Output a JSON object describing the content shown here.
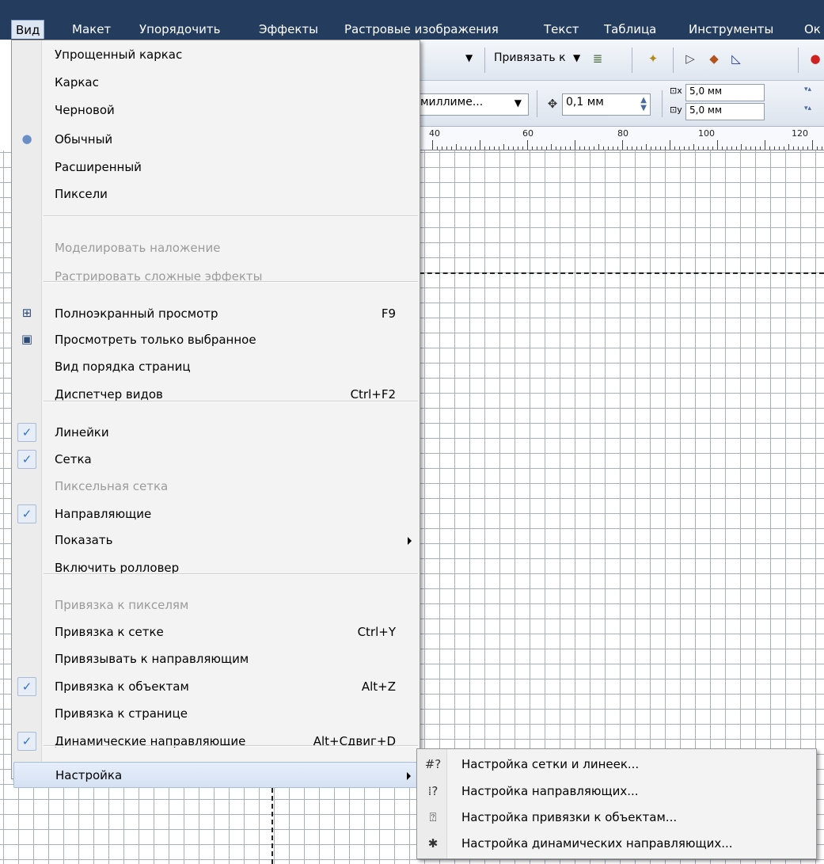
{
  "menubar": {
    "items": [
      "Вид",
      "Макет",
      "Упорядочить",
      "Эффекты",
      "Растровые изображения",
      "Текст",
      "Таблица",
      "Инструменты",
      "Ок"
    ]
  },
  "toolbar": {
    "snap_label": "Привязать к",
    "units": "миллиме...",
    "nudge": "0,1 мм",
    "dup_x": "5,0 мм",
    "dup_y": "5,0 мм"
  },
  "ruler": {
    "labels": [
      "40",
      "60",
      "80",
      "100",
      "120"
    ]
  },
  "view_menu": {
    "items": [
      {
        "label": "Упрощенный каркас",
        "shortcut": "",
        "state": "normal",
        "icon": ""
      },
      {
        "label": "Каркас",
        "shortcut": "",
        "state": "normal",
        "icon": ""
      },
      {
        "label": "Черновой",
        "shortcut": "",
        "state": "normal",
        "icon": ""
      },
      {
        "label": "Обычный",
        "shortcut": "",
        "state": "normal",
        "icon": "radio-dot-icon"
      },
      {
        "label": "Расширенный",
        "shortcut": "",
        "state": "normal",
        "icon": ""
      },
      {
        "label": "Пиксели",
        "shortcut": "",
        "state": "normal",
        "icon": ""
      },
      {
        "label": "Моделировать наложение",
        "shortcut": "",
        "state": "disabled",
        "icon": ""
      },
      {
        "label": "Растрировать сложные эффекты",
        "shortcut": "",
        "state": "disabled",
        "icon": ""
      },
      {
        "label": "Полноэкранный просмотр",
        "shortcut": "F9",
        "state": "normal",
        "icon": "fullscreen-icon"
      },
      {
        "label": "Просмотреть только выбранное",
        "shortcut": "",
        "state": "normal",
        "icon": "view-selected-icon"
      },
      {
        "label": "Вид порядка страниц",
        "shortcut": "",
        "state": "normal",
        "icon": ""
      },
      {
        "label": "Диспетчер видов",
        "shortcut": "Ctrl+F2",
        "state": "normal",
        "icon": ""
      },
      {
        "label": "Линейки",
        "shortcut": "",
        "state": "normal",
        "icon": "check-icon"
      },
      {
        "label": "Сетка",
        "shortcut": "",
        "state": "normal",
        "icon": "check-icon"
      },
      {
        "label": "Пиксельная сетка",
        "shortcut": "",
        "state": "disabled",
        "icon": ""
      },
      {
        "label": "Направляющие",
        "shortcut": "",
        "state": "normal",
        "icon": "check-icon"
      },
      {
        "label": "Показать",
        "shortcut": "",
        "state": "normal",
        "icon": "",
        "submenu": true
      },
      {
        "label": "Включить ролловер",
        "shortcut": "",
        "state": "normal",
        "icon": ""
      },
      {
        "label": "Привязка к пикселям",
        "shortcut": "",
        "state": "disabled",
        "icon": ""
      },
      {
        "label": "Привязка к сетке",
        "shortcut": "Ctrl+Y",
        "state": "normal",
        "icon": ""
      },
      {
        "label": "Привязывать к направляющим",
        "shortcut": "",
        "state": "normal",
        "icon": ""
      },
      {
        "label": "Привязка к объектам",
        "shortcut": "Alt+Z",
        "state": "normal",
        "icon": "check-icon"
      },
      {
        "label": "Привязка к странице",
        "shortcut": "",
        "state": "normal",
        "icon": ""
      },
      {
        "label": "Динамические направляющие",
        "shortcut": "Alt+Сдвиг+D",
        "state": "normal",
        "icon": "check-icon"
      },
      {
        "label": "Настройка",
        "shortcut": "",
        "state": "highlight",
        "icon": "",
        "submenu": true
      }
    ]
  },
  "sub_menu": {
    "items": [
      {
        "label": "Настройка сетки и линеек...",
        "icon": "grid-setup-icon"
      },
      {
        "label": "Настройка направляющих...",
        "icon": "guides-setup-icon"
      },
      {
        "label": "Настройка привязки к объектам...",
        "icon": "snap-objects-icon"
      },
      {
        "label": "Настройка динамических направляющих...",
        "icon": "dynamic-guides-icon"
      }
    ]
  },
  "icons": {
    "radio-dot-icon": "●",
    "check-icon": "✓",
    "fullscreen-icon": "⊞",
    "view-selected-icon": "▣",
    "grid-setup-icon": "#?",
    "guides-setup-icon": "⁞?",
    "snap-objects-icon": "⍰",
    "dynamic-guides-icon": "✱"
  }
}
